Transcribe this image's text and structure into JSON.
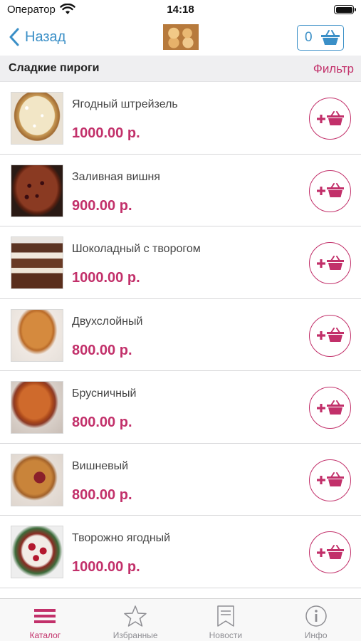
{
  "status_bar": {
    "carrier": "Оператор",
    "time": "14:18"
  },
  "nav": {
    "back_label": "Назад",
    "cart_count": "0"
  },
  "section": {
    "title": "Сладкие пироги",
    "filter_label": "Фильтр"
  },
  "colors": {
    "accent": "#c2306a",
    "link": "#3a8fc7"
  },
  "products": [
    {
      "name": "Ягодный штрейзель",
      "price": "1000.00 р.",
      "image": "streusel-pie"
    },
    {
      "name": "Заливная вишня",
      "price": "900.00 р.",
      "image": "cherry-pie"
    },
    {
      "name": "Шоколадный с творогом",
      "price": "1000.00 р.",
      "image": "chocolate-curd-cake"
    },
    {
      "name": "Двухслойный",
      "price": "800.00 р.",
      "image": "two-layer-pie"
    },
    {
      "name": "Брусничный",
      "price": "800.00 р.",
      "image": "lingonberry-pie"
    },
    {
      "name": "Вишневый",
      "price": "800.00 р.",
      "image": "cherry-slice-pie"
    },
    {
      "name": "Творожно ягодный",
      "price": "1000.00 р.",
      "image": "curd-berry-cake"
    }
  ],
  "tabs": [
    {
      "label": "Каталог",
      "icon": "menu-icon",
      "active": true
    },
    {
      "label": "Избранные",
      "icon": "star-icon",
      "active": false
    },
    {
      "label": "Новости",
      "icon": "bookmark-icon",
      "active": false
    },
    {
      "label": "Инфо",
      "icon": "info-icon",
      "active": false
    }
  ]
}
